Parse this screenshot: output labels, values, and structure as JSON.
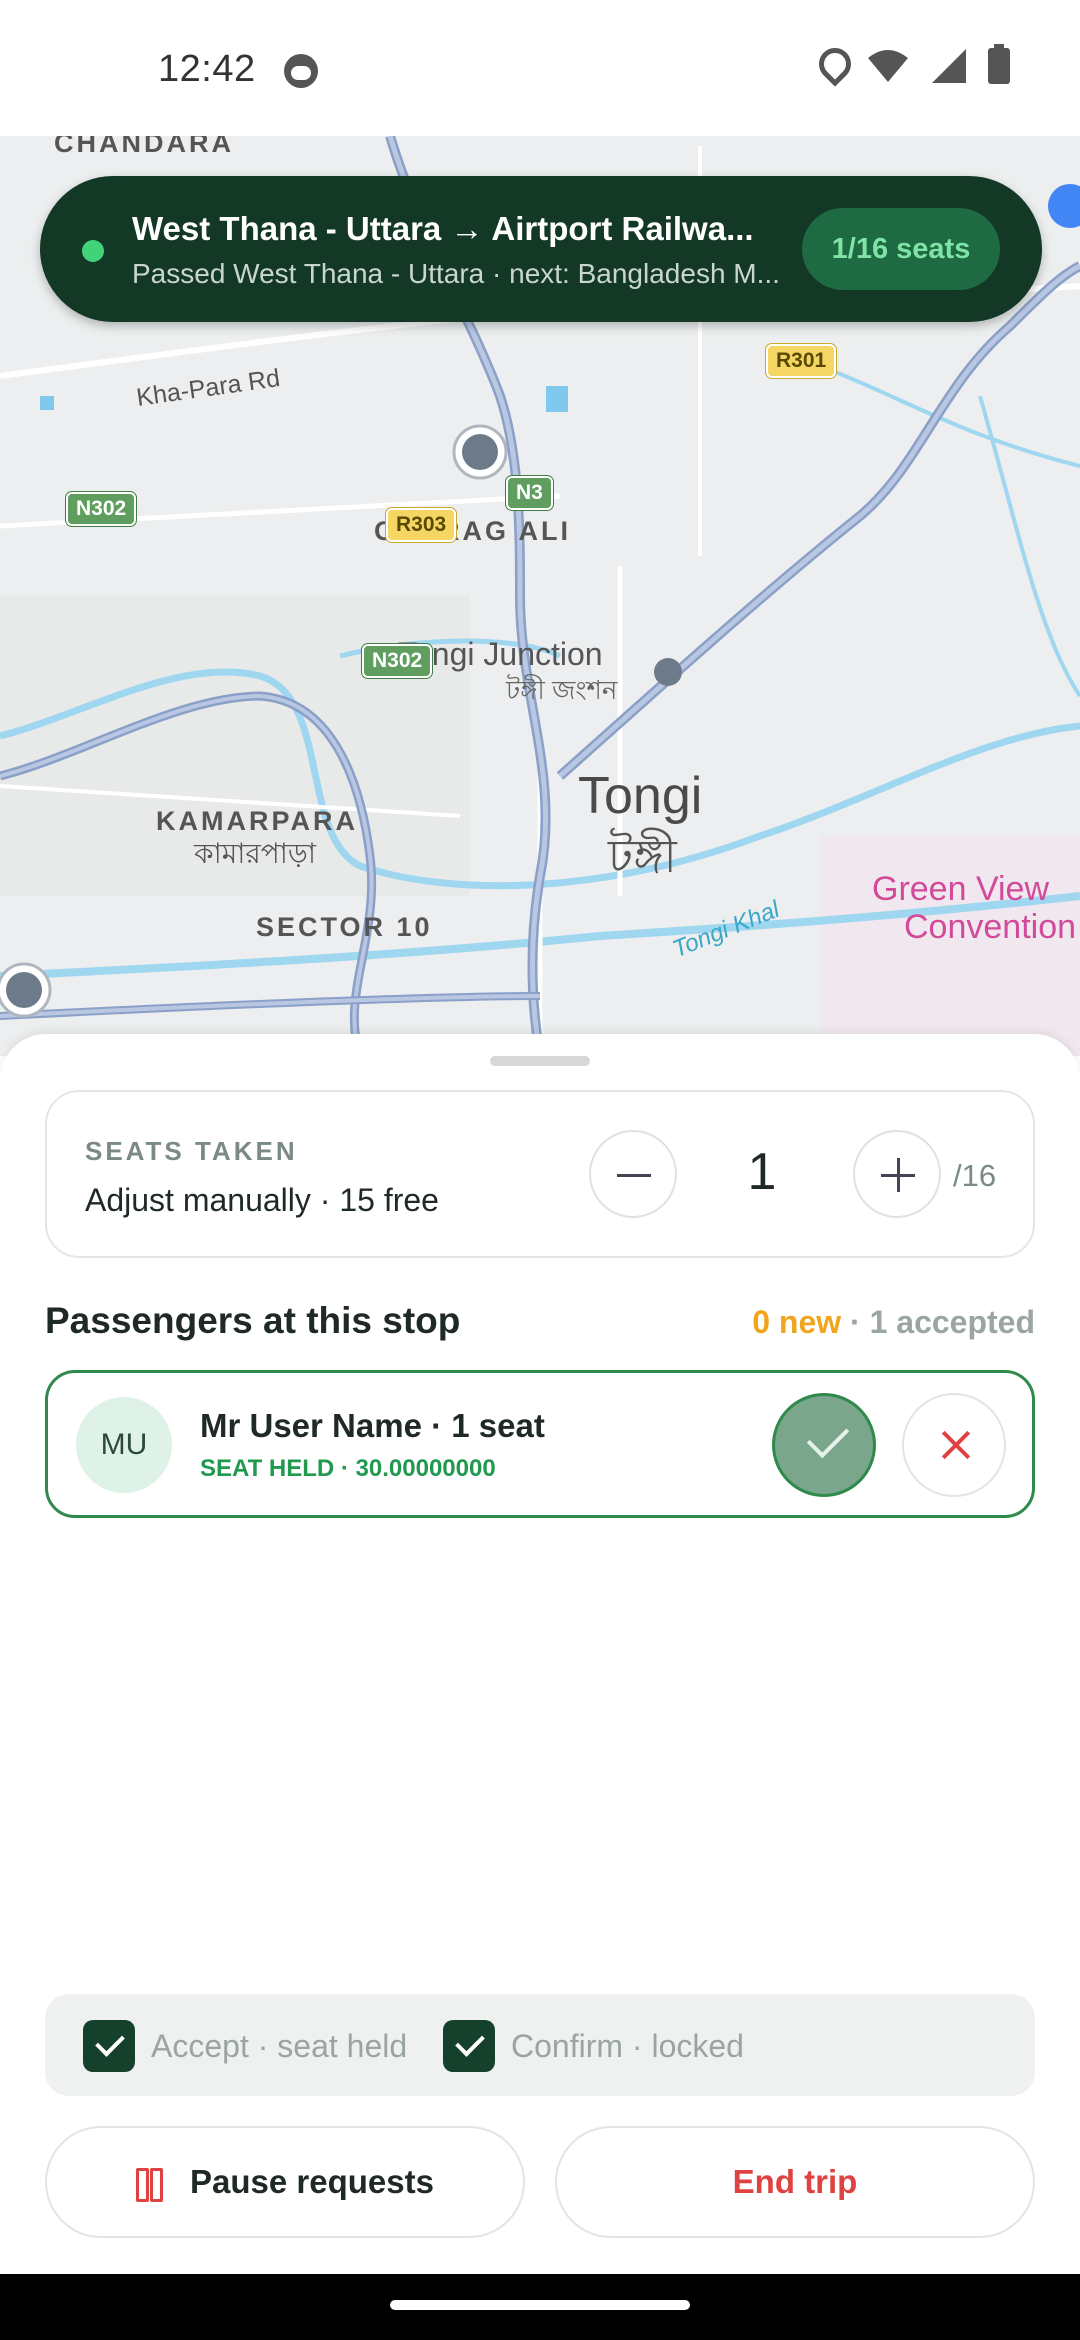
{
  "status_bar": {
    "time": "12:42"
  },
  "map": {
    "area_labels": {
      "chandara": "CHANDARA",
      "cherag_ali": "CHERAG ALI",
      "kamarpara": "KAMARPARA",
      "kamarpara_bn": "কামারপাড়া",
      "sector10": "SECTOR 10"
    },
    "town_label": "Tongi",
    "town_label_bn": "টঙ্গী",
    "junction_label": "Tongi Junction",
    "junction_label_bn": "টঙ্গী জংশন",
    "road_label": "Kha-Para Rd",
    "water_label": "Tongi Khal",
    "poi_label_1": "Green View",
    "poi_label_2": "Convention",
    "shields": {
      "r301": "R301",
      "r303": "R303",
      "n3": "N3",
      "n302_left": "N302",
      "n302_bottom": "N302"
    }
  },
  "banner": {
    "title": "West Thana - Uttara → Airtport Railwa...",
    "subtitle": "Passed West Thana - Uttara · next: Bangladesh M...",
    "badge": "1/16 seats"
  },
  "seats": {
    "label": "SEATS TAKEN",
    "subtitle": "Adjust manually · 15 free",
    "count": "1",
    "total": "/16"
  },
  "passengers": {
    "title": "Passengers at this stop",
    "new_count": "0 new",
    "separator": " · ",
    "accepted_count": "1 accepted",
    "items": [
      {
        "initials": "MU",
        "name": "Mr User Name · 1 seat",
        "status": "SEAT HELD · 30.00000000"
      }
    ]
  },
  "checks": {
    "accept": "Accept · seat held",
    "confirm": "Confirm · locked"
  },
  "actions": {
    "pause": "Pause requests",
    "end": "End trip"
  },
  "colors": {
    "banner_bg": "#133826",
    "accent_green": "#2f8a4c",
    "danger_red": "#e04141",
    "new_orange": "#f0a51c"
  }
}
